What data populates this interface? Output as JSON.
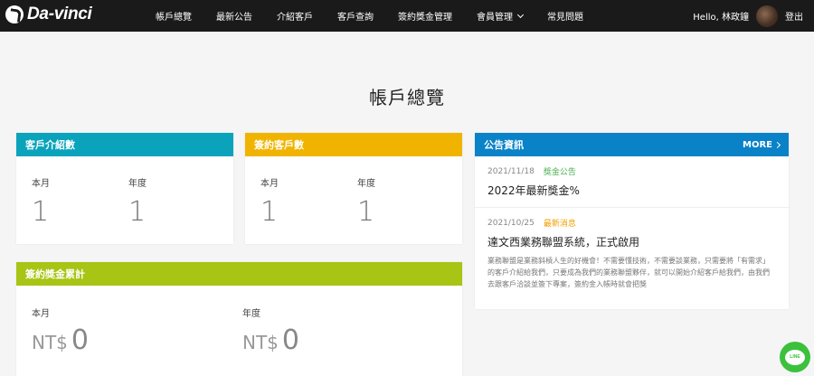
{
  "brand": {
    "name": "Da-vinci"
  },
  "nav": {
    "items": [
      {
        "label": "帳戶總覽"
      },
      {
        "label": "最新公告"
      },
      {
        "label": "介紹客戶"
      },
      {
        "label": "客戶查詢"
      },
      {
        "label": "簽約獎金管理"
      },
      {
        "label": "會員管理"
      },
      {
        "label": "常見問題"
      }
    ],
    "greeting": "Hello, 林政鐘",
    "logout": "登出"
  },
  "page": {
    "title": "帳戶總覽"
  },
  "referral_card": {
    "title": "客戶介紹數",
    "color": "#0aa3bb",
    "month_label": "本月",
    "month_value": "1",
    "year_label": "年度",
    "year_value": "1"
  },
  "signed_card": {
    "title": "簽約客戶數",
    "color": "#f0b400",
    "month_label": "本月",
    "month_value": "1",
    "year_label": "年度",
    "year_value": "1"
  },
  "bonus_card": {
    "title": "簽約獎金累計",
    "color": "#a8c415",
    "month_label": "本月",
    "month_currency": "NT$",
    "month_value": "0",
    "year_label": "年度",
    "year_currency": "NT$",
    "year_value": "0"
  },
  "announcements": {
    "title": "公告資訊",
    "color": "#0a82c7",
    "more_label": "MORE",
    "items": [
      {
        "date": "2021/11/18",
        "tag": "獎金公告",
        "tag_color": "#4caf50",
        "title": "2022年最新獎金%"
      },
      {
        "date": "2021/10/25",
        "tag": "最新消息",
        "tag_color": "#f0a000",
        "title": "達文西業務聯盟系統，正式啟用",
        "desc": "業務聯盟是業務斜槓人生的好機會！不需要懂技術，不需要談業務，只需要將「有需求」的客戶介紹給我們，只要成為我們的業務聯盟夥伴，就可以開始介紹客戶給我們，由我們去跟客戶洽談並簽下專案，簽約金入帳時就會把獎"
      }
    ]
  },
  "line_button": {
    "label": "LINE",
    "color": "#3bc13c"
  }
}
